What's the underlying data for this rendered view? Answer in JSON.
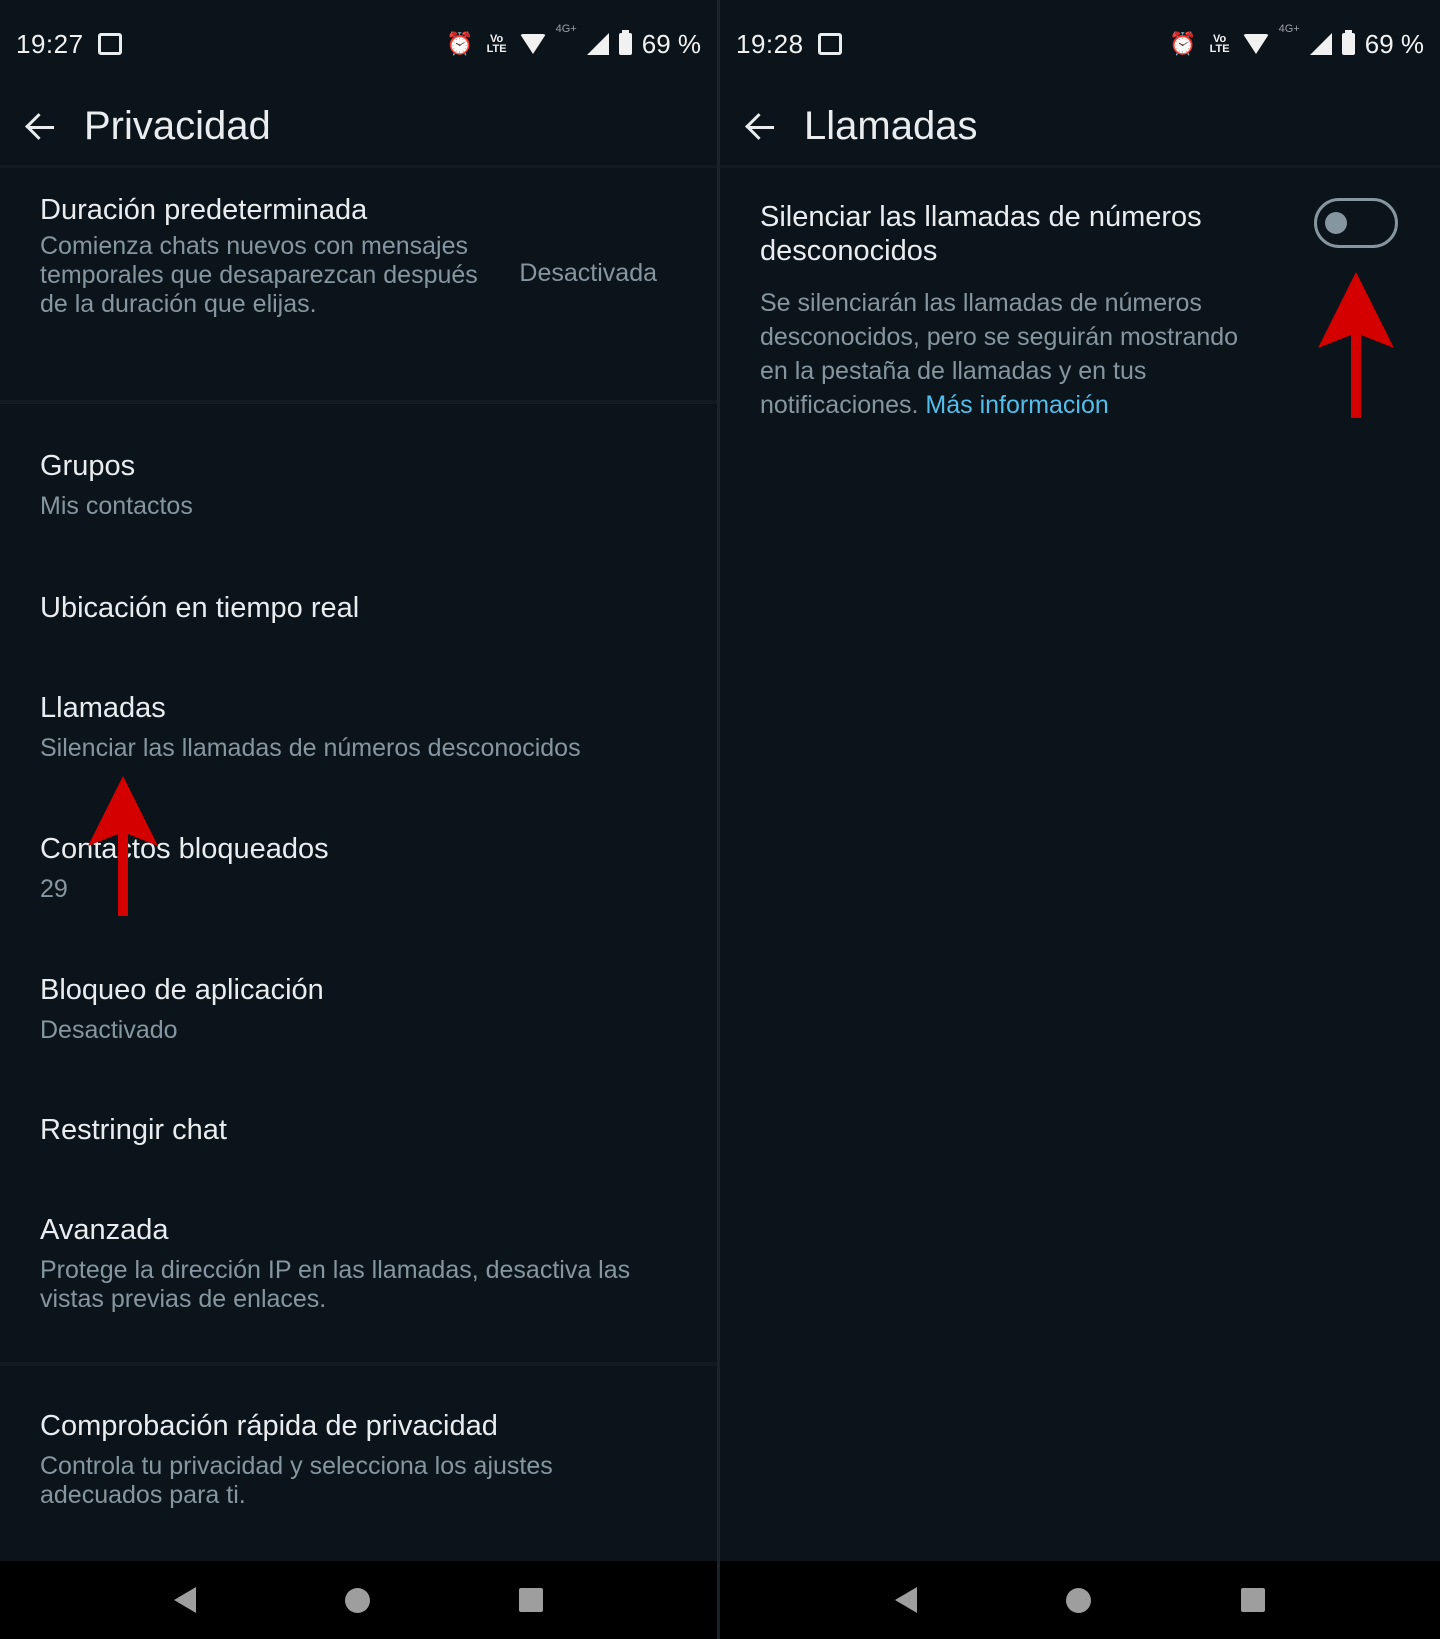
{
  "left": {
    "status": {
      "time": "19:27",
      "net": "4G+",
      "battery": "69 %"
    },
    "title": "Privacidad",
    "items": [
      {
        "title": "Duración predeterminada",
        "subtitle": "Comienza chats nuevos con mensajes temporales que desaparezcan después de la duración que elijas.",
        "value": "Desactivada"
      },
      {
        "title": "Grupos",
        "subtitle": "Mis contactos"
      },
      {
        "title": "Ubicación en tiempo real"
      },
      {
        "title": "Llamadas",
        "subtitle": "Silenciar las llamadas de números desconocidos"
      },
      {
        "title": "Contactos bloqueados",
        "subtitle": "29"
      },
      {
        "title": "Bloqueo de aplicación",
        "subtitle": "Desactivado"
      },
      {
        "title": "Restringir chat"
      },
      {
        "title": "Avanzada",
        "subtitle": "Protege la dirección IP en las llamadas, desactiva las vistas previas de enlaces."
      },
      {
        "title": "Comprobación rápida de privacidad",
        "subtitle": "Controla tu privacidad y selecciona los ajustes adecuados para ti."
      }
    ]
  },
  "right": {
    "status": {
      "time": "19:28",
      "net": "4G+",
      "battery": "69 %"
    },
    "title": "Llamadas",
    "setting": {
      "title": "Silenciar las llamadas de números desconocidos",
      "description": "Se silenciarán las llamadas de números desconocidos, pero se seguirán mostrando en la pestaña de llamadas y en tus notificaciones.",
      "link": "Más información",
      "enabled": false
    }
  },
  "colors": {
    "background": "#0b141a",
    "text": "#e9edef",
    "secondary": "#8696a0",
    "link": "#53bdeb",
    "annotation_arrow": "#d40000"
  }
}
